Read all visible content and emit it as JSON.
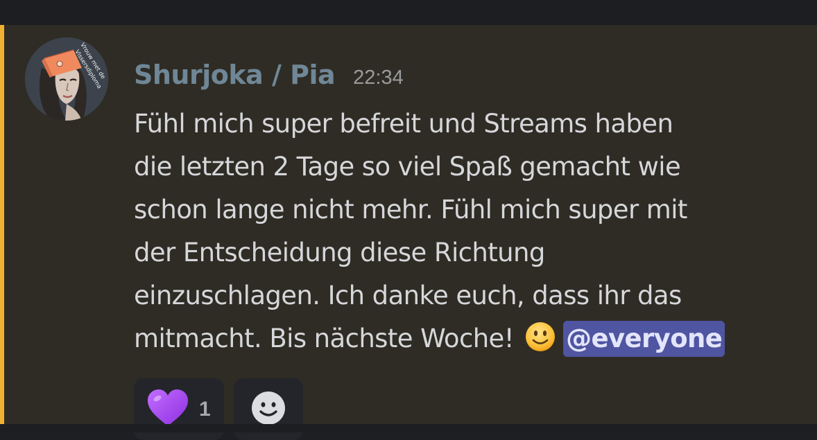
{
  "message": {
    "author": "Shurjoka / Pia",
    "timestamp": "22:34",
    "avatar": {
      "icon": "avatar-image",
      "sticker_text": "Vrouw met de Vissersdiploma"
    },
    "content_lines": [
      "Fühl mich super befreit und Streams haben",
      "die letzten 2 Tage so viel Spaß gemacht wie",
      "schon lange nicht mehr. Fühl mich super mit",
      "der Entscheidung diese Richtung",
      "einzuschlagen. Ich danke euch, dass ihr das",
      "mitmacht. Bis nächste Woche!"
    ],
    "inline_emoji": "slightly-smiling-face",
    "mention": "@everyone",
    "highlight_color": "#f0b132"
  },
  "reactions": [
    {
      "emoji": "purple-heart",
      "count": "1"
    },
    {
      "emoji": "add-reaction-smiley-icon"
    }
  ]
}
